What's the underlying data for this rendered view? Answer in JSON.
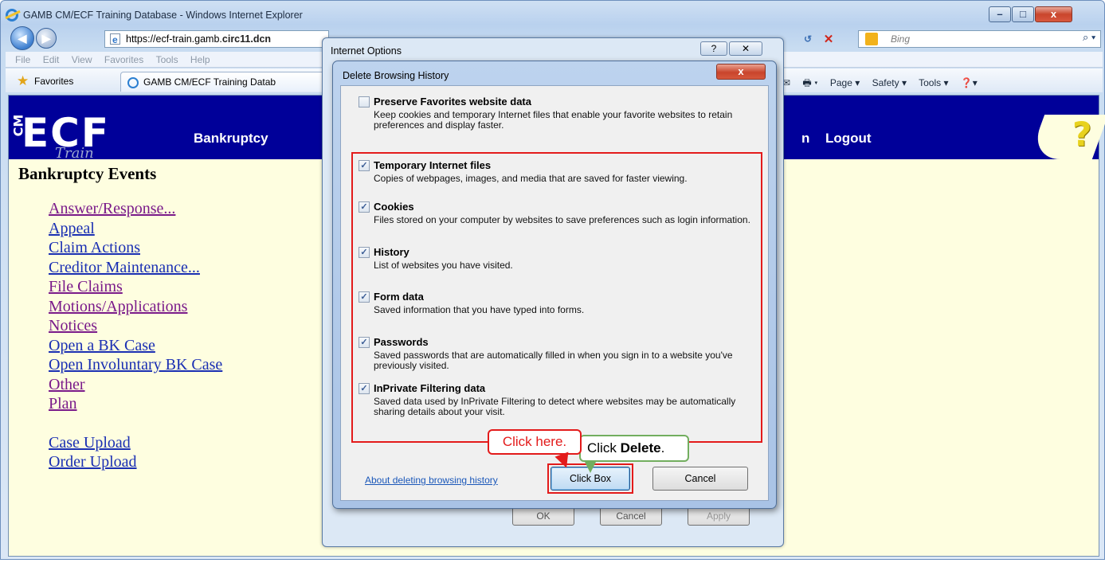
{
  "window": {
    "title": "GAMB CM/ECF Training Database - Windows Internet Explorer",
    "minimize": "–",
    "maximize": "□",
    "close": "x"
  },
  "nav": {
    "back": "◀",
    "forward": "▶",
    "address_domain_prefix": "https://ecf-train.gamb.",
    "address_domain": "circ11.dcn",
    "search_placeholder": "Bing",
    "search_go": "⌕ ▾",
    "refresh": "↺",
    "stop": "✕"
  },
  "menubar": {
    "items": [
      "File",
      "Edit",
      "View",
      "Favorites",
      "Tools",
      "Help"
    ]
  },
  "favbar": {
    "favorites_label": "Favorites",
    "tab_title": "GAMB CM/ECF Training Datab",
    "commands": [
      "Page ▾",
      "Safety ▾",
      "Tools ▾",
      "❓▾"
    ]
  },
  "page": {
    "logo_cm": "CM",
    "logo_ecf": "ECF",
    "logo_train": "Train",
    "nav_bankruptcy": "Bankruptcy",
    "nav_fragment": "n",
    "nav_logout": "Logout",
    "help_q": "?",
    "heading": "Bankruptcy Events",
    "links": [
      {
        "label": "Answer/Response...",
        "visited": true
      },
      {
        "label": "Appeal",
        "visited": false
      },
      {
        "label": "Claim Actions",
        "visited": false
      },
      {
        "label": "Creditor Maintenance...",
        "visited": false
      },
      {
        "label": "File Claims",
        "visited": true
      },
      {
        "label": "Motions/Applications",
        "visited": true
      },
      {
        "label": "Notices",
        "visited": true
      },
      {
        "label": "Open a BK Case",
        "visited": false
      },
      {
        "label": "Open Involuntary BK Case",
        "visited": false
      },
      {
        "label": "Other",
        "visited": true
      },
      {
        "label": "Plan",
        "visited": true
      }
    ],
    "links2": [
      {
        "label": "Case Upload",
        "visited": false
      },
      {
        "label": "Order Upload",
        "visited": false
      }
    ]
  },
  "internet_options": {
    "title": "Internet Options",
    "help": "?",
    "close": "✕",
    "ok": "OK",
    "cancel": "Cancel",
    "apply": "Apply"
  },
  "delete_history": {
    "title": "Delete Browsing History",
    "close": "x",
    "options": [
      {
        "label": "Preserve Favorites website data",
        "checked": false,
        "desc": "Keep cookies and temporary Internet files that enable your favorite websites to retain preferences and display faster."
      },
      {
        "label": "Temporary Internet files",
        "checked": true,
        "desc": "Copies of webpages, images, and media that are saved for faster viewing."
      },
      {
        "label": "Cookies",
        "checked": true,
        "desc": "Files stored on your computer by websites to save preferences such as login information."
      },
      {
        "label": "History",
        "checked": true,
        "desc": "List of websites you have visited."
      },
      {
        "label": "Form data",
        "checked": true,
        "desc": "Saved information that you have typed into forms."
      },
      {
        "label": "Passwords",
        "checked": true,
        "desc": "Saved passwords that are automatically filled in when you sign in to a website you've previously visited."
      },
      {
        "label": "InPrivate Filtering data",
        "checked": true,
        "desc": "Saved data used by InPrivate Filtering to detect where websites may be automatically sharing details about your visit."
      }
    ],
    "about_link": "About deleting browsing history",
    "delete_button": "Click Box",
    "cancel_button": "Cancel"
  },
  "callouts": {
    "click_here": "Click here.",
    "click_delete_prefix": "Click ",
    "click_delete_bold": "Delete",
    "click_delete_suffix": "."
  },
  "colors": {
    "banner": "#000099",
    "page_bg": "#fefee0",
    "highlight_red": "#e31b1b",
    "callout_green": "#72ae5f"
  }
}
